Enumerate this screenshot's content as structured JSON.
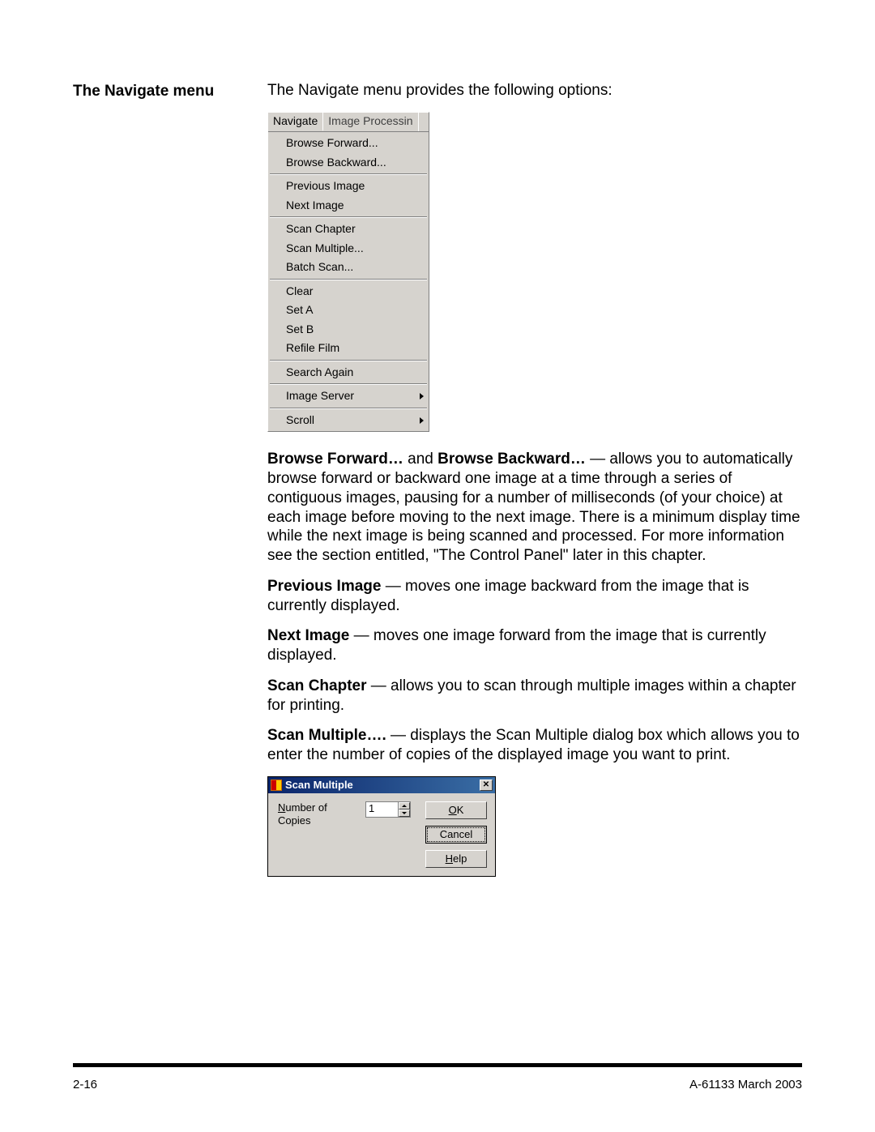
{
  "label_heading": "The Navigate menu",
  "intro": "The Navigate menu provides the following options:",
  "menu": {
    "tabs": {
      "navigate": "Navigate",
      "image_processing": "Image Processin"
    },
    "groups": [
      [
        "Browse Forward...",
        "Browse Backward..."
      ],
      [
        "Previous Image",
        "Next Image"
      ],
      [
        "Scan Chapter",
        "Scan Multiple...",
        "Batch Scan..."
      ],
      [
        "Clear",
        "Set A",
        "Set B",
        "Refile Film"
      ],
      [
        "Search Again"
      ]
    ],
    "submenus": [
      "Image Server",
      "Scroll"
    ]
  },
  "paragraphs": {
    "browse": {
      "b1": "Browse Forward…",
      "mid1": " and ",
      "b2": "Browse Backward…",
      "rest": " — allows you to automatically browse forward or backward one image at a time through a series of contiguous images, pausing for a number of milliseconds (of your choice) at each image before moving to the next image.  There is a minimum display time while the next image is being scanned and processed. For more information see the section entitled, \"The Control Panel\" later in this chapter."
    },
    "previous": {
      "b": "Previous Image",
      "rest": " — moves one image backward from the image that is currently displayed."
    },
    "next": {
      "b": "Next Image",
      "rest": " — moves one image forward from the image that is currently displayed."
    },
    "chapter": {
      "b": "Scan Chapter",
      "rest": " — allows you to scan through multiple images within a chapter for printing."
    },
    "multiple": {
      "b": "Scan Multiple….",
      "rest": " — displays the Scan Multiple dialog box which allows you to enter the number of copies of the displayed image you want to print."
    }
  },
  "dialog": {
    "title": "Scan Multiple",
    "copies_label_pre": "N",
    "copies_label_rest": "umber of Copies",
    "copies_value": "1",
    "ok_pre": "O",
    "ok_rest": "K",
    "cancel": "Cancel",
    "help_pre": "H",
    "help_rest": "elp"
  },
  "footer": {
    "left": "2-16",
    "right": "A-61133  March 2003"
  }
}
